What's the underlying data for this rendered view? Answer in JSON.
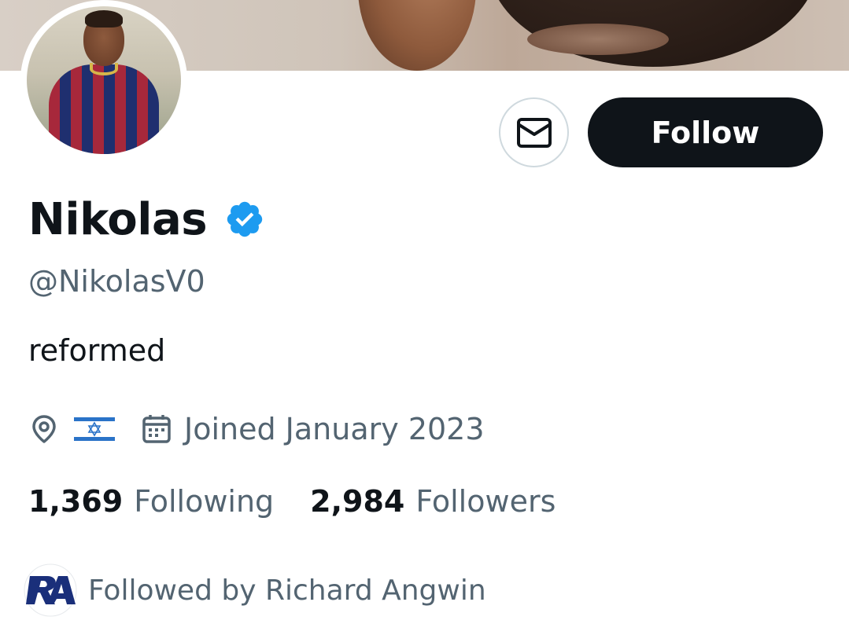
{
  "profile": {
    "name": "Nikolas",
    "handle": "@NikolasV0",
    "bio": "reformed",
    "joined": "Joined January 2023",
    "verified": true
  },
  "actions": {
    "follow_label": "Follow"
  },
  "stats": {
    "following_count": "1,369",
    "following_label": "Following",
    "followers_count": "2,984",
    "followers_label": "Followers"
  },
  "followed_by": {
    "text": "Followed by Richard Angwin",
    "avatar_initials": "RA"
  },
  "colors": {
    "text_primary": "#0f1419",
    "text_secondary": "#536471",
    "verified_blue": "#1d9bf0",
    "follow_button_bg": "#0f1419",
    "border": "#cfd9de"
  },
  "icons": {
    "message": "envelope-icon",
    "location": "location-pin-icon",
    "flag": "israel-flag-icon",
    "calendar": "calendar-icon",
    "verified": "verified-badge-icon"
  }
}
